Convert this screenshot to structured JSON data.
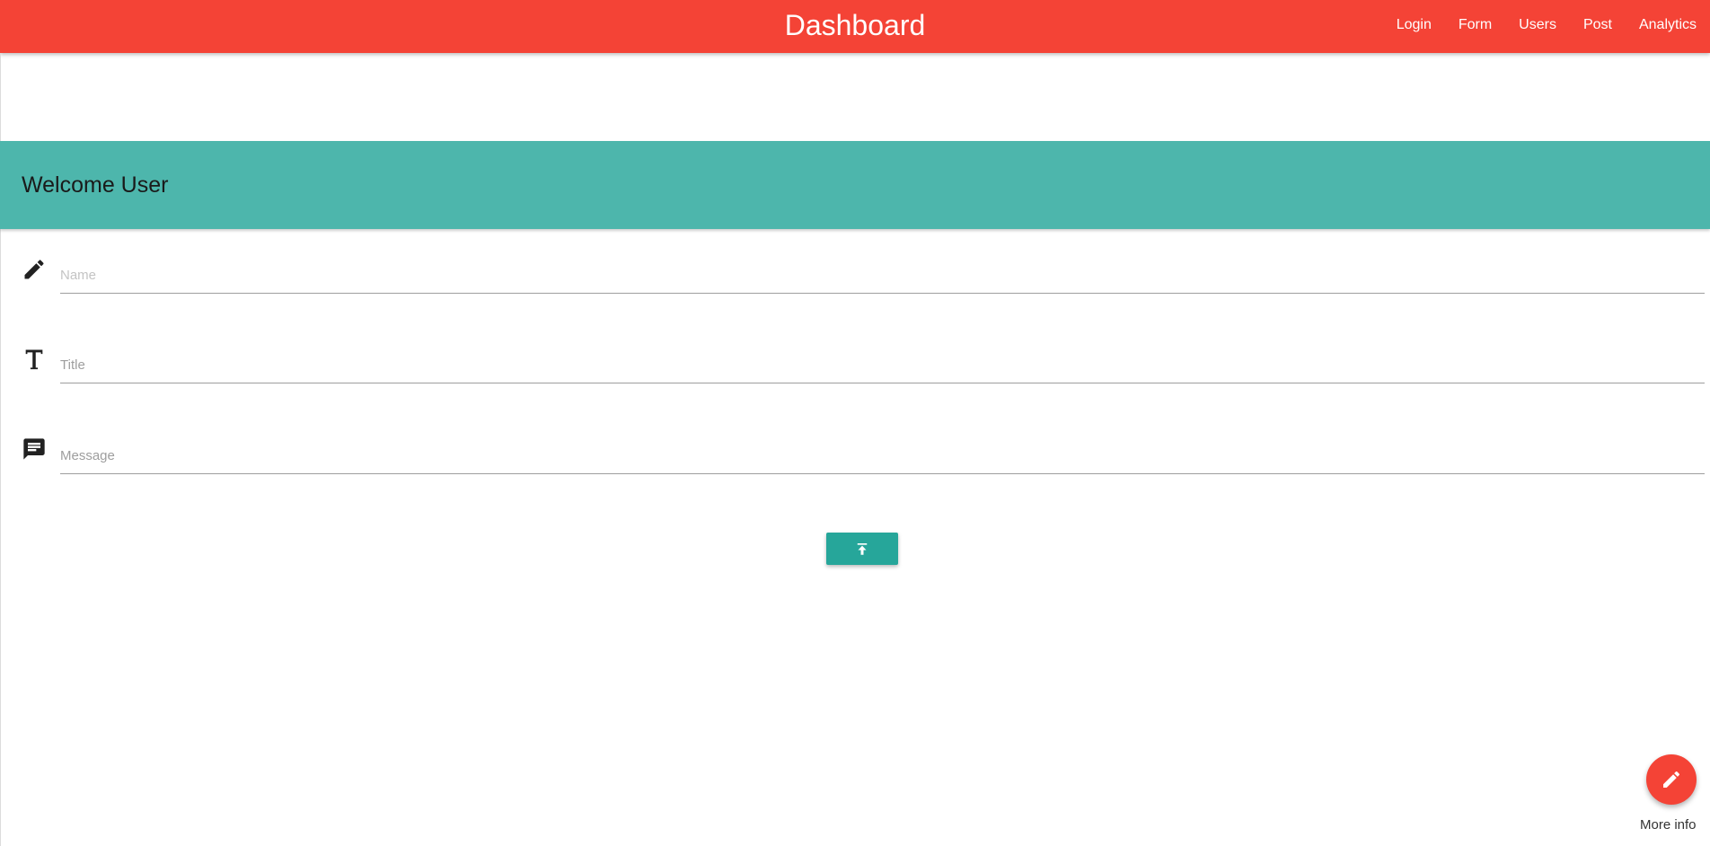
{
  "navbar": {
    "brand": "Dashboard",
    "links": [
      {
        "label": "Login"
      },
      {
        "label": "Form"
      },
      {
        "label": "Users"
      },
      {
        "label": "Post"
      },
      {
        "label": "Analytics"
      }
    ],
    "color": "#f44336"
  },
  "welcome": {
    "title": "Welcome User",
    "color": "#4db6ac"
  },
  "form": {
    "fields": [
      {
        "icon": "pencil-icon",
        "placeholder": "Name",
        "value": ""
      },
      {
        "icon": "text-format-icon",
        "placeholder": "Title",
        "value": ""
      },
      {
        "icon": "message-icon",
        "placeholder": "Message",
        "value": ""
      }
    ],
    "submit": {
      "icon": "upload-icon",
      "color": "#26a69a"
    }
  },
  "fab": {
    "icon": "pencil-icon",
    "label": "More info",
    "color": "#f44336"
  }
}
